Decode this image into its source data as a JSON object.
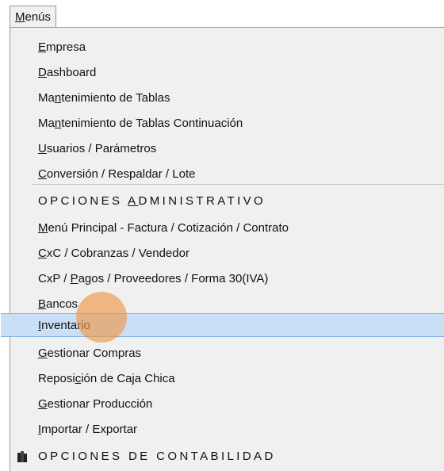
{
  "menubar": {
    "title_underlined": "M",
    "title_rest": "enús"
  },
  "items": [
    {
      "pre": "",
      "ul": "E",
      "post": "mpresa"
    },
    {
      "pre": "",
      "ul": "D",
      "post": "ashboard"
    },
    {
      "pre": "Ma",
      "ul": "n",
      "post": "tenimiento de Tablas"
    },
    {
      "pre": "Ma",
      "ul": "n",
      "post": "tenimiento de Tablas Continuación"
    },
    {
      "pre": "",
      "ul": "U",
      "post": "suarios / Parámetros"
    },
    {
      "pre": "",
      "ul": "C",
      "post": "onversión / Respaldar / Lote"
    },
    {
      "pre": "OPCIONES ",
      "ul": "A",
      "post": "DMINISTRATIVO",
      "header": true
    },
    {
      "pre": "",
      "ul": "M",
      "post": "enú Principal - Factura / Cotización / Contrato"
    },
    {
      "pre": "",
      "ul": "C",
      "post": "xC / Cobranzas / Vendedor"
    },
    {
      "pre": "CxP / ",
      "ul": "P",
      "post": "agos / Proveedores / Forma 30(IVA)"
    },
    {
      "pre": "",
      "ul": "B",
      "post": "ancos"
    },
    {
      "pre": "",
      "ul": "I",
      "post": "nventario",
      "selected": true
    },
    {
      "pre": "",
      "ul": "G",
      "post": "estionar Compras"
    },
    {
      "pre": "Reposi",
      "ul": "c",
      "post": "ión de Caja Chica"
    },
    {
      "pre": "",
      "ul": "G",
      "post": "estionar Producción"
    },
    {
      "pre": "",
      "ul": "I",
      "post": "mportar / Exportar"
    },
    {
      "pre": "OPCIONES DE CONTABILIDAD",
      "ul": "",
      "post": "",
      "header": true
    }
  ],
  "icons": {
    "cursor": "click-highlight",
    "section": "book-icon"
  },
  "colors": {
    "menu_bg": "#f0f0f0",
    "selected_bg": "#c8dff5",
    "selected_border": "#7fb3e0",
    "cursor": "#ee9646"
  }
}
